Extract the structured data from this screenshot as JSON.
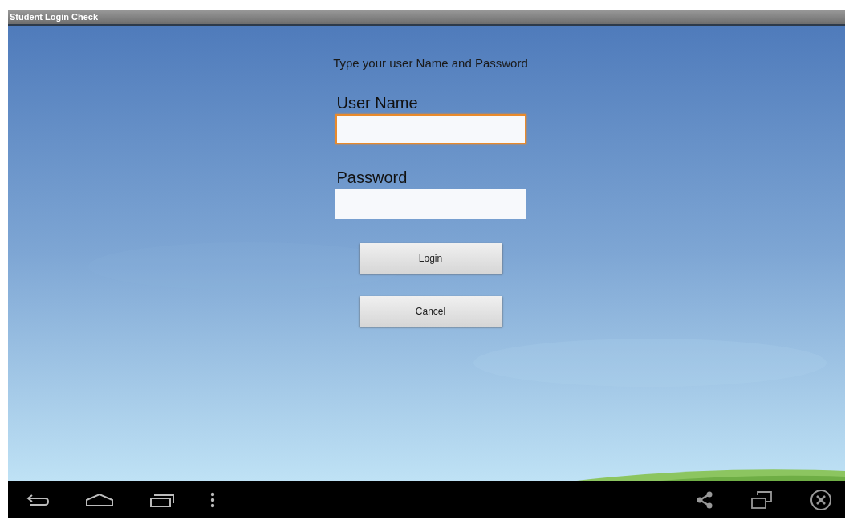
{
  "window": {
    "title": "Student Login Check"
  },
  "form": {
    "prompt": "Type your user Name and Password",
    "fields": [
      {
        "label": "User Name",
        "focused": true
      },
      {
        "label": "Password",
        "focused": false
      }
    ],
    "buttons": [
      "Login",
      "Cancel"
    ]
  }
}
